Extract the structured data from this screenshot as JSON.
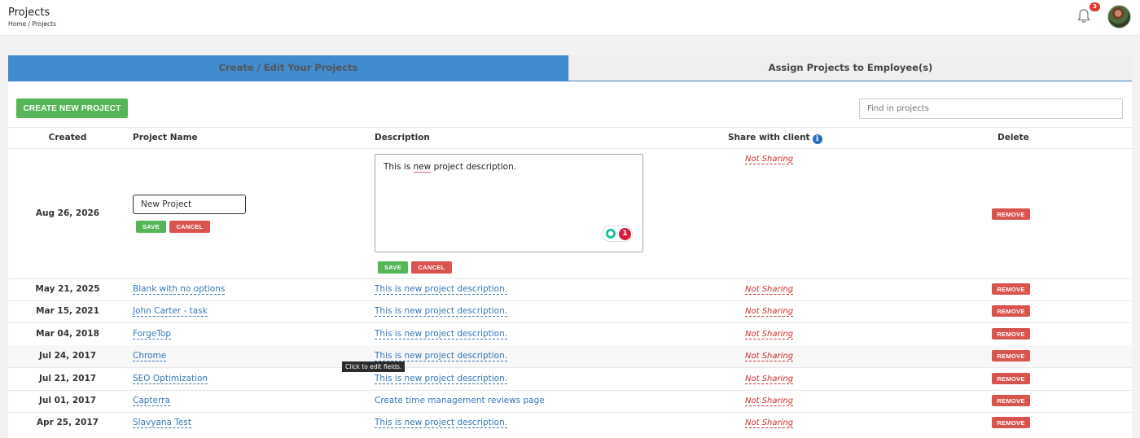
{
  "header": {
    "title": "Projects",
    "breadcrumb": "Home / Projects",
    "notification_count": "3"
  },
  "tabs": [
    {
      "label": "Create / Edit Your Projects",
      "active": true
    },
    {
      "label": "Assign Projects to Employee(s)",
      "active": false
    }
  ],
  "toolbar": {
    "create_label": "CREATE NEW PROJECT",
    "search_placeholder": "Find in projects"
  },
  "table": {
    "columns": [
      "Created",
      "Project Name",
      "Description",
      "Share with client",
      "Delete"
    ],
    "editing_row": {
      "date": "Aug 26, 2026",
      "name_value": "New Project",
      "description_before": "This is ",
      "description_flagged": "new",
      "description_after": " project description.",
      "share": "Not Sharing",
      "grammar_issues": "1",
      "save_label": "SAVE",
      "cancel_label": "CANCEL"
    },
    "rows": [
      {
        "date": "May 21, 2025",
        "name": "Blank with no options",
        "description": "This is new project description.",
        "share": "Not Sharing"
      },
      {
        "date": "Mar 15, 2021",
        "name": "John Carter - task",
        "description": "This is new project description.",
        "share": "Not Sharing"
      },
      {
        "date": "Mar 04, 2018",
        "name": "ForgeTop",
        "description": "This is new project description.",
        "share": "Not Sharing"
      },
      {
        "date": "Jul 24, 2017",
        "name": "Chrome",
        "description": "This is new project description.",
        "share": "Not Sharing"
      },
      {
        "date": "Jul 21, 2017",
        "name": "SEO Optimization",
        "description": "This is new project description.",
        "share": "Not Sharing"
      },
      {
        "date": "Jul 01, 2017",
        "name": "Capterra",
        "description": "Create time management reviews page",
        "share": "Not Sharing"
      },
      {
        "date": "Apr 25, 2017",
        "name": "Slavyana Test",
        "description": "This is new project description.",
        "share": "Not Sharing"
      }
    ],
    "remove_label": "REMOVE"
  },
  "tooltip": "Click to edit fields.",
  "icons": {
    "bell": "bell-icon",
    "info": "info-icon",
    "avatar": "avatar"
  },
  "colors": {
    "primary": "#418bcf",
    "success": "#55b658",
    "danger": "#d9534f",
    "link": "#3677b9"
  }
}
